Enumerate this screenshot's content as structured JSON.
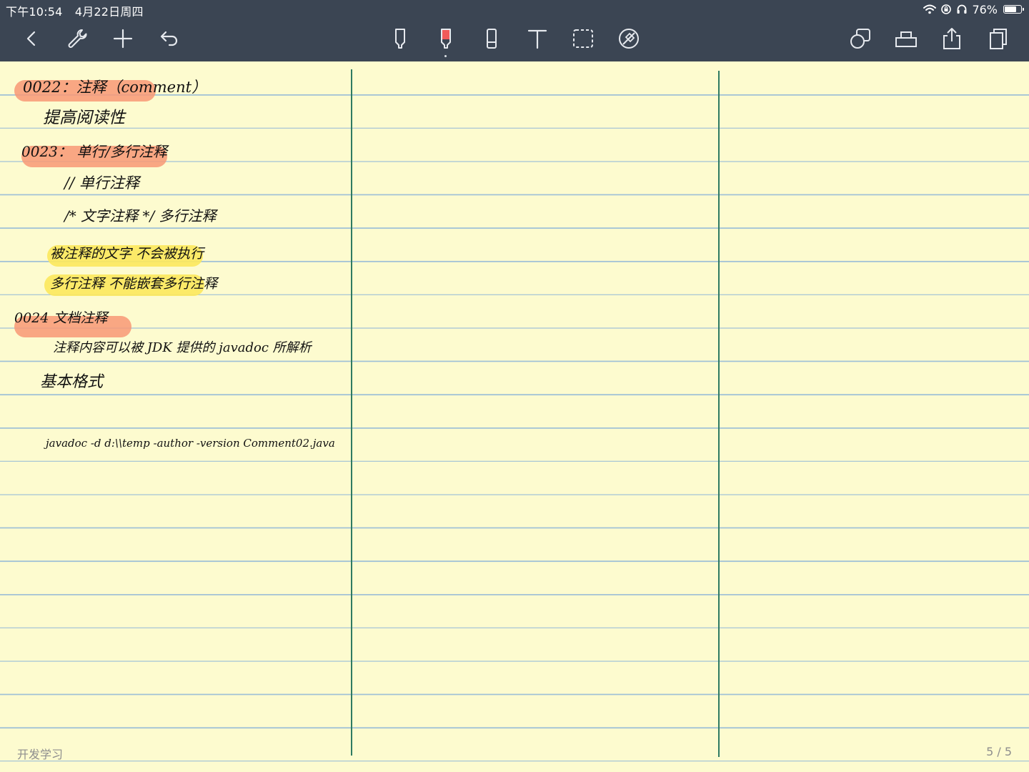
{
  "status_bar": {
    "time": "下午10:54",
    "date": "4月22日周四",
    "battery": "76%",
    "battery_level": 0.76
  },
  "toolbar": {
    "left": [
      "back-icon",
      "wrench-icon",
      "plus-icon",
      "undo-icon"
    ],
    "center": [
      "pen-icon",
      "highlighter-icon",
      "eraser-icon",
      "text-icon",
      "lasso-select-icon",
      "laser-pointer-icon"
    ],
    "right": [
      "shapes-icon",
      "ruler-icon",
      "share-icon",
      "pages-icon"
    ],
    "active_tool": "highlighter",
    "colors": {
      "bar": "#3b4553",
      "highlighter_active": "#f05a5a"
    }
  },
  "notes": {
    "line1": "0022：注释（comment）",
    "line2": "提高阅读性",
    "line3": "0023： 单行/多行注释",
    "line4": "// 单行注释",
    "line5": "/* 文字注释 */ 多行注释",
    "line6": "被注释的文字 不会被执行",
    "line7": "多行注释 不能嵌套多行注释",
    "line8": "0024 文档注释",
    "line9": "注释内容可以被 JDK 提供的 javadoc 所解析",
    "line10": "基本格式",
    "line11": "javadoc -d d:\\\\temp -author -version Comment02.java"
  },
  "highlights": {
    "orange": "#f8986f",
    "yellow": "#fce85c"
  },
  "paper": {
    "background": "#fdfbcf",
    "rule_color": "#9fc0d6",
    "margin_color": "#2e7a62"
  },
  "footer": {
    "notebook_name": "开发学习",
    "page_indicator": "5 / 5"
  }
}
